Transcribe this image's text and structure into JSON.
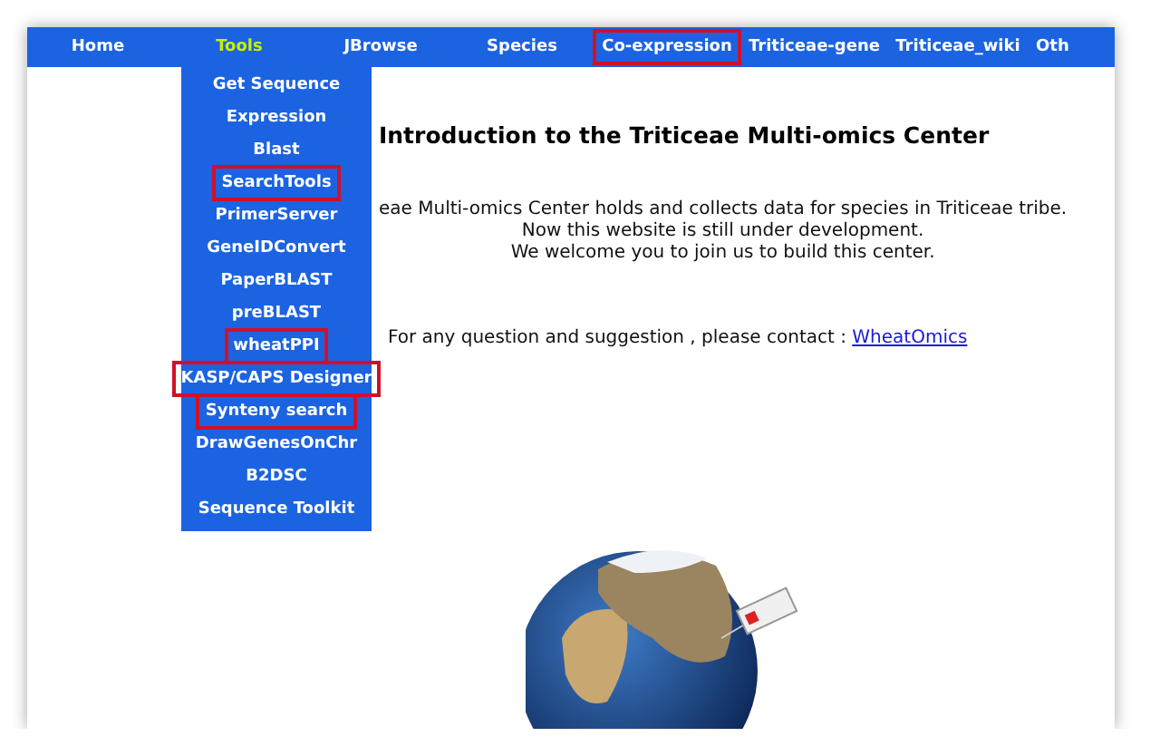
{
  "nav": [
    {
      "label": "Home",
      "selected": false,
      "highlighted": false
    },
    {
      "label": "Tools",
      "selected": true,
      "highlighted": false
    },
    {
      "label": "JBrowse",
      "selected": false,
      "highlighted": false
    },
    {
      "label": "Species",
      "selected": false,
      "highlighted": false
    },
    {
      "label": "Co-expression",
      "selected": false,
      "highlighted": true
    },
    {
      "label": "Triticeae-gene",
      "selected": false,
      "highlighted": false
    },
    {
      "label": "Triticeae_wiki",
      "selected": false,
      "highlighted": false
    },
    {
      "label": "Oth",
      "selected": false,
      "highlighted": false
    }
  ],
  "tools_menu": [
    {
      "label": "Get Sequence",
      "highlighted": false
    },
    {
      "label": "Expression",
      "highlighted": false
    },
    {
      "label": "Blast",
      "highlighted": false
    },
    {
      "label": "SearchTools",
      "highlighted": true
    },
    {
      "label": "PrimerServer",
      "highlighted": false
    },
    {
      "label": "GeneIDConvert",
      "highlighted": false
    },
    {
      "label": "PaperBLAST",
      "highlighted": false
    },
    {
      "label": "preBLAST",
      "highlighted": false
    },
    {
      "label": "wheatPPI",
      "highlighted": true
    },
    {
      "label": "KASP/CAPS Designer",
      "highlighted": true
    },
    {
      "label": "Synteny search",
      "highlighted": true
    },
    {
      "label": "DrawGenesOnChr",
      "highlighted": false
    },
    {
      "label": "B2DSC",
      "highlighted": false
    },
    {
      "label": "Sequence Toolkit",
      "highlighted": false
    }
  ],
  "intro": {
    "title": "Introduction to the Triticeae Multi-omics Center",
    "lines": [
      "eae Multi-omics Center holds and collects data for species in Triticeae tribe.",
      "Now this website is still under development.",
      "We welcome you to join us to build this center."
    ],
    "contact": "For any question and suggestion , please contact :",
    "contact_link": "WheatOmics"
  }
}
